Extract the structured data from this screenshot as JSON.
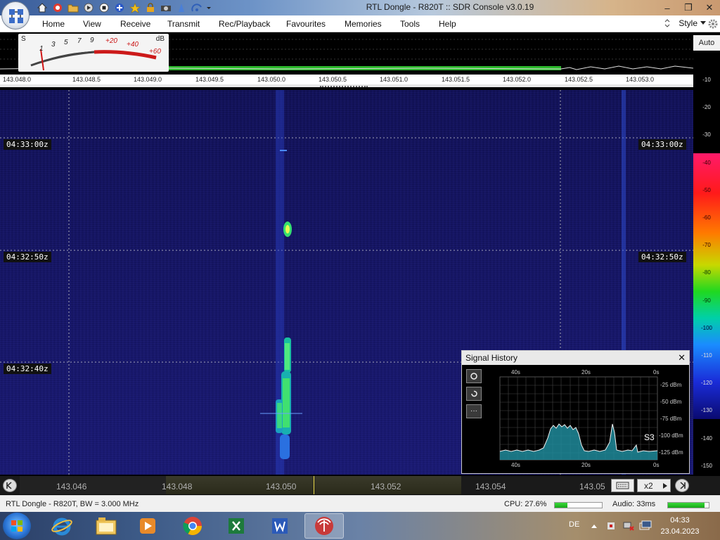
{
  "window": {
    "title": "RTL Dongle - R820T :: SDR Console v3.0.19",
    "minimize_glyph": "–",
    "restore_glyph": "❐",
    "close_glyph": "✕"
  },
  "quick_access": [
    "home-icon",
    "help-lifebuoy-icon",
    "folder-icon",
    "play-icon",
    "stop-icon",
    "add-icon",
    "favourite-star-icon",
    "lock-icon",
    "camera-icon",
    "signal-icon",
    "wave-icon",
    "dropdown-icon"
  ],
  "menu": {
    "items": [
      "Home",
      "View",
      "Receive",
      "Transmit",
      "Rec/Playback",
      "Favourites",
      "Memories",
      "Tools",
      "Help"
    ],
    "style_label": "Style"
  },
  "smeter": {
    "s_label": "S",
    "db_label": "dB",
    "scale": [
      "1",
      "3",
      "5",
      "7",
      "9",
      "+20",
      "+40",
      "+60"
    ]
  },
  "top_frequency_scale": [
    "143.048.0",
    "143.048.5",
    "143.049.0",
    "143.049.5",
    "143.050.0",
    "143.050.5",
    "143.051.0",
    "143.051.5",
    "143.052.0",
    "143.052.5",
    "143.053.0"
  ],
  "db_panel": {
    "auto_label": "Auto",
    "labels": [
      "-10",
      "-20",
      "-30",
      "-40",
      "-50",
      "-60",
      "-70",
      "-80",
      "-90",
      "-100",
      "-110",
      "-120",
      "-130",
      "-140",
      "-150"
    ]
  },
  "waterfall": {
    "time_labels": [
      "04:33:00z",
      "04:32:50z",
      "04:32:40z"
    ]
  },
  "signal_history": {
    "title": "Signal History",
    "close_glyph": "✕",
    "x_labels": [
      "40s",
      "20s",
      "0s"
    ],
    "y_labels": [
      "-25 dBm",
      "-50 dBm",
      "-75 dBm",
      "-100 dBm",
      "-125 dBm"
    ],
    "s_reading": "S3",
    "tool_buttons": [
      "record-icon",
      "reset-icon",
      "more-icon"
    ],
    "more_label": "···"
  },
  "bottom_scale": {
    "labels": [
      "143.046",
      "143.048",
      "143.050",
      "143.052",
      "143.054",
      "143.05"
    ],
    "zoom_label": "x2"
  },
  "status": {
    "device": "RTL Dongle - R820T, BW = 3.000 MHz",
    "cpu_label": "CPU: 27.6%",
    "cpu_percent": 27.6,
    "audio_label": "Audio: 33ms",
    "audio_level": 0.9
  },
  "taskbar": {
    "apps": [
      "internet-explorer-icon",
      "file-explorer-icon",
      "media-player-icon",
      "chrome-icon",
      "excel-icon",
      "word-icon",
      "sdr-console-icon"
    ],
    "language": "DE",
    "time": "04:33",
    "date": "23.04.2023"
  },
  "colors": {
    "waterfall_bg": "#10105a",
    "signal_green": "#36e070",
    "meter_red": "#cc1a1a"
  }
}
